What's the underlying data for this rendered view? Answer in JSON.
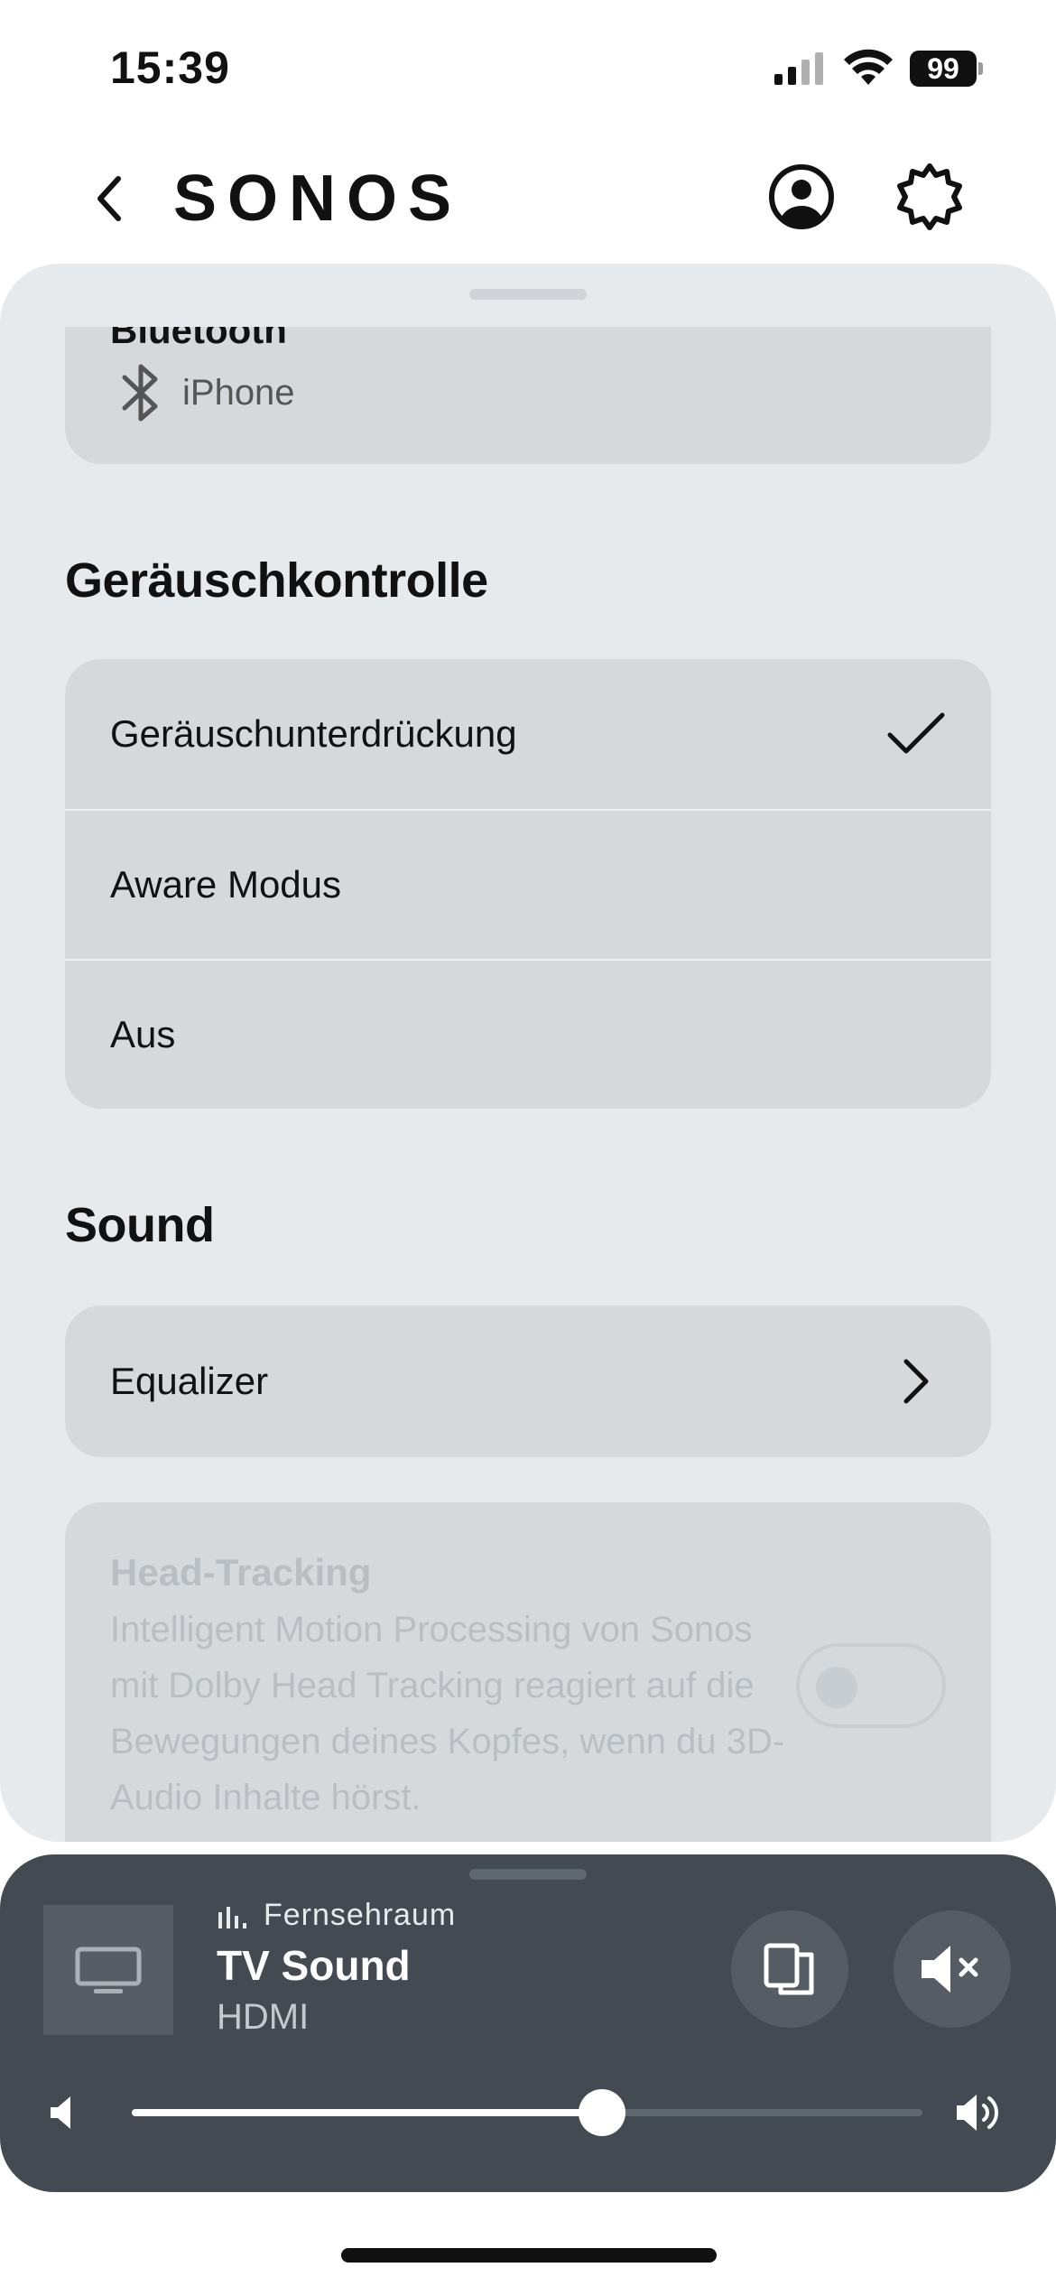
{
  "status_bar": {
    "time": "15:39",
    "battery": "99"
  },
  "header": {
    "logo": "SONOS"
  },
  "bluetooth": {
    "title": "Bluetooth",
    "device": "iPhone"
  },
  "noise_control": {
    "title": "Geräuschkontrolle",
    "options": [
      {
        "label": "Geräuschunterdrückung",
        "selected": true
      },
      {
        "label": "Aware Modus",
        "selected": false
      },
      {
        "label": "Aus",
        "selected": false
      }
    ]
  },
  "sound": {
    "title": "Sound",
    "equalizer_label": "Equalizer",
    "head_tracking": {
      "title": "Head-Tracking",
      "description": "Intelligent Motion Processing von Sonos mit Dolby Head Tracking reagiert auf die Bewegungen deines Kopfes, wenn du 3D-Audio Inhalte hörst.",
      "enabled": false
    }
  },
  "player": {
    "room": "Fernsehraum",
    "title": "TV Sound",
    "source": "HDMI",
    "volume_fraction": 0.595,
    "muted": true
  },
  "colors": {
    "sheet_bg": "#e7eaed",
    "card_bg": "#d5d9dc",
    "player_bg": "#434a52",
    "disabled_text": "#b9bec3"
  }
}
